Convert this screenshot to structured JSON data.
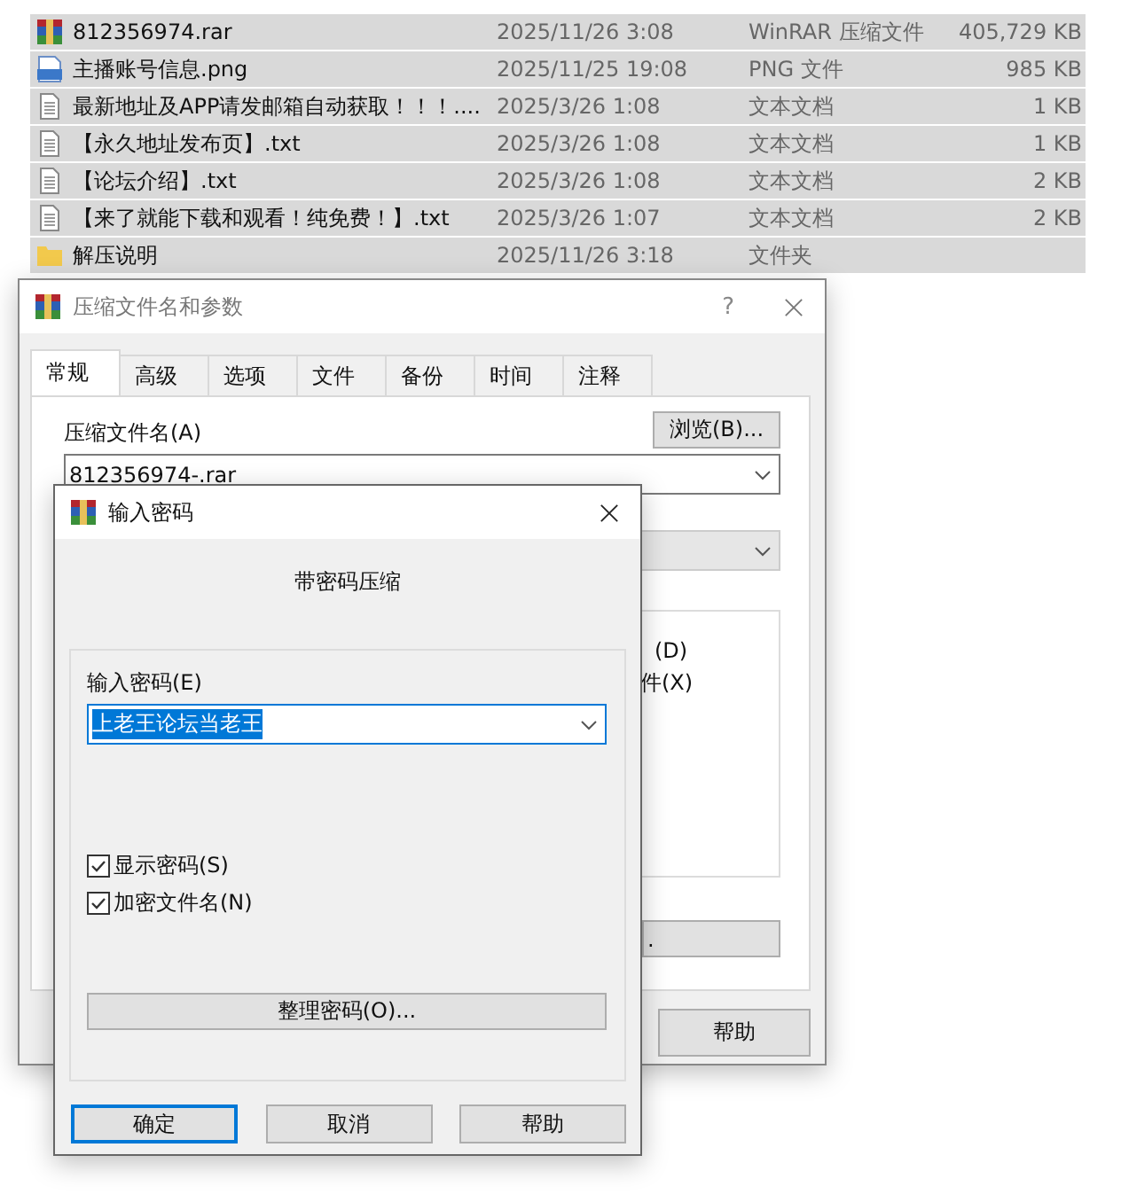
{
  "files": [
    {
      "kind": "rar",
      "name": "812356974.rar",
      "date": "2025/11/26 3:08",
      "type": "WinRAR 压缩文件",
      "size": "405,729 KB",
      "selected": true
    },
    {
      "kind": "png",
      "name": "主播账号信息.png",
      "date": "2025/11/25 19:08",
      "type": "PNG 文件",
      "size": "985 KB",
      "selected": true
    },
    {
      "kind": "txt",
      "name": "最新地址及APP请发邮箱自动获取！！！....",
      "date": "2025/3/26 1:08",
      "type": "文本文档",
      "size": "1 KB",
      "selected": true
    },
    {
      "kind": "txt",
      "name": "【永久地址发布页】.txt",
      "date": "2025/3/26 1:08",
      "type": "文本文档",
      "size": "1 KB",
      "selected": true
    },
    {
      "kind": "txt",
      "name": "【论坛介绍】.txt",
      "date": "2025/3/26 1:08",
      "type": "文本文档",
      "size": "2 KB",
      "selected": true
    },
    {
      "kind": "txt",
      "name": "【来了就能下载和观看！纯免费！】.txt",
      "date": "2025/3/26 1:07",
      "type": "文本文档",
      "size": "2 KB",
      "selected": true
    },
    {
      "kind": "folder",
      "name": "解压说明",
      "date": "2025/11/26 3:18",
      "type": "文件夹",
      "selected": true
    }
  ],
  "archive_dialog": {
    "title": "压缩文件名和参数",
    "help_glyph": "?",
    "tabs": [
      {
        "label": "常规",
        "selected": true
      },
      {
        "label": "高级",
        "selected": false
      },
      {
        "label": "选项",
        "selected": false
      },
      {
        "label": "文件",
        "selected": false
      },
      {
        "label": "备份",
        "selected": false
      },
      {
        "label": "时间",
        "selected": false
      },
      {
        "label": "注释",
        "selected": false
      }
    ],
    "archive_name_label": "压缩文件名(A)",
    "browse_button": "浏览(B)...",
    "archive_name": "812356974-.rar",
    "partial_options": [
      "(D)",
      "件(X)"
    ],
    "partial_button": ".",
    "help_button": "帮助"
  },
  "password_dialog": {
    "title": "输入密码",
    "heading": "带密码压缩",
    "password_label": "输入密码(E)",
    "password": "上老王论坛当老王",
    "checkboxes": [
      {
        "label": "显示密码(S)",
        "checked": true
      },
      {
        "label": "加密文件名(N)",
        "checked": true
      }
    ],
    "organize_button": "整理密码(O)...",
    "buttons": [
      {
        "label": "确定",
        "focused": true
      },
      {
        "label": "取消",
        "focused": false
      },
      {
        "label": "帮助",
        "focused": false
      }
    ]
  }
}
